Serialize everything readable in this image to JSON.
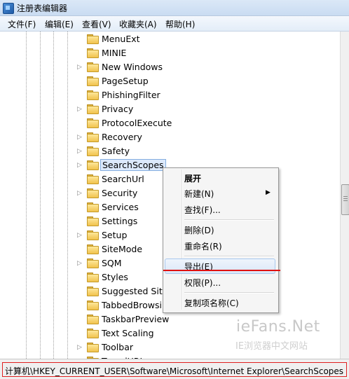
{
  "window": {
    "title": "注册表编辑器"
  },
  "menubar": {
    "items": [
      "文件(F)",
      "编辑(E)",
      "查看(V)",
      "收藏夹(A)",
      "帮助(H)"
    ]
  },
  "tree": {
    "items": [
      {
        "label": "MenuExt",
        "expander": false
      },
      {
        "label": "MINIE",
        "expander": false
      },
      {
        "label": "New Windows",
        "expander": true
      },
      {
        "label": "PageSetup",
        "expander": false
      },
      {
        "label": "PhishingFilter",
        "expander": false
      },
      {
        "label": "Privacy",
        "expander": true
      },
      {
        "label": "ProtocolExecute",
        "expander": false
      },
      {
        "label": "Recovery",
        "expander": true
      },
      {
        "label": "Safety",
        "expander": true
      },
      {
        "label": "SearchScopes",
        "expander": true,
        "selected": true
      },
      {
        "label": "SearchUrl",
        "expander": false
      },
      {
        "label": "Security",
        "expander": true
      },
      {
        "label": "Services",
        "expander": false
      },
      {
        "label": "Settings",
        "expander": false
      },
      {
        "label": "Setup",
        "expander": true
      },
      {
        "label": "SiteMode",
        "expander": false
      },
      {
        "label": "SQM",
        "expander": true
      },
      {
        "label": "Styles",
        "expander": false
      },
      {
        "label": "Suggested Sites",
        "expander": false
      },
      {
        "label": "TabbedBrowsing",
        "expander": false
      },
      {
        "label": "TaskbarPreview",
        "expander": false
      },
      {
        "label": "Text Scaling",
        "expander": false
      },
      {
        "label": "Toolbar",
        "expander": true
      },
      {
        "label": "TypedURLs",
        "expander": false
      }
    ]
  },
  "context_menu": {
    "expand": "展开",
    "new": "新建(N)",
    "find": "查找(F)...",
    "delete": "删除(D)",
    "rename": "重命名(R)",
    "export": "导出(E)",
    "permissions": "权限(P)...",
    "copy_key_name": "复制项名称(C)"
  },
  "watermark": {
    "brand": "ieFans.Net",
    "subtitle": "IE浏览器中文网站"
  },
  "statusbar": {
    "path": "计算机\\HKEY_CURRENT_USER\\Software\\Microsoft\\Internet Explorer\\SearchScopes"
  },
  "colors": {
    "highlight_box": "#e02020",
    "selection": "#dce9fb",
    "folder": "#f1c24c"
  }
}
